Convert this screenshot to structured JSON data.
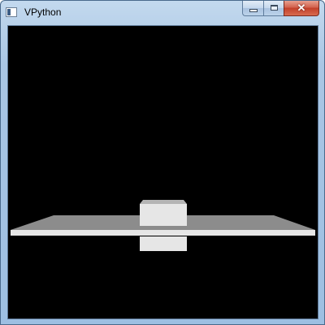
{
  "window": {
    "title": "VPython",
    "icon": "app-window-icon"
  },
  "controls": {
    "minimize_icon": "minimize-icon",
    "maximize_icon": "maximize-icon",
    "close_icon": "close-icon",
    "close_glyph": "✕"
  },
  "scene": {
    "background_color": "#000000",
    "floor_top_color": "#8c8c8c",
    "floor_front_color": "#e6e6e6",
    "box_color": "#e6e6e6",
    "box_top_color": "#b4b4b4"
  }
}
